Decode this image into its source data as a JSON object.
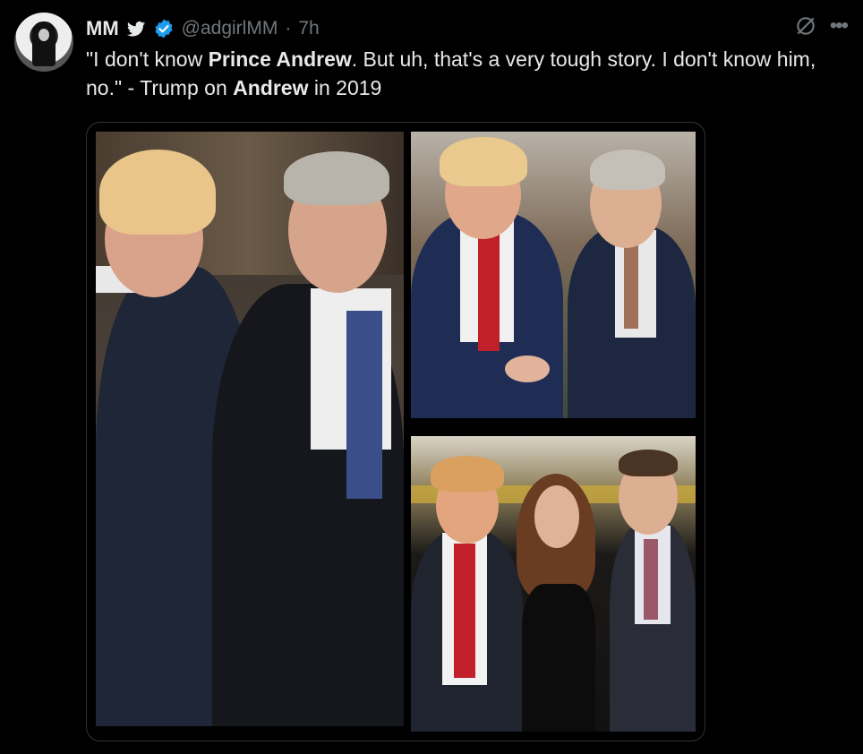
{
  "tweet": {
    "author_name": "MM",
    "handle": "@adgirlMM",
    "separator": "·",
    "time": "7h",
    "text_parts": [
      {
        "t": "\"I don't know ",
        "b": false
      },
      {
        "t": "Prince Andrew",
        "b": true
      },
      {
        "t": ". But uh, that's a very tough story. I don't know him, no.\" - Trump on ",
        "b": false
      },
      {
        "t": "Andrew",
        "b": true
      },
      {
        "t": " in 2019",
        "b": false
      }
    ]
  },
  "icons": {
    "bird": "bird-icon",
    "verified": "verified-badge-icon",
    "grok": "grok-icon",
    "more": "more-icon"
  },
  "colors": {
    "background": "#000000",
    "text": "#e7e9ea",
    "muted": "#71767b",
    "verified": "#1d9bf0"
  }
}
